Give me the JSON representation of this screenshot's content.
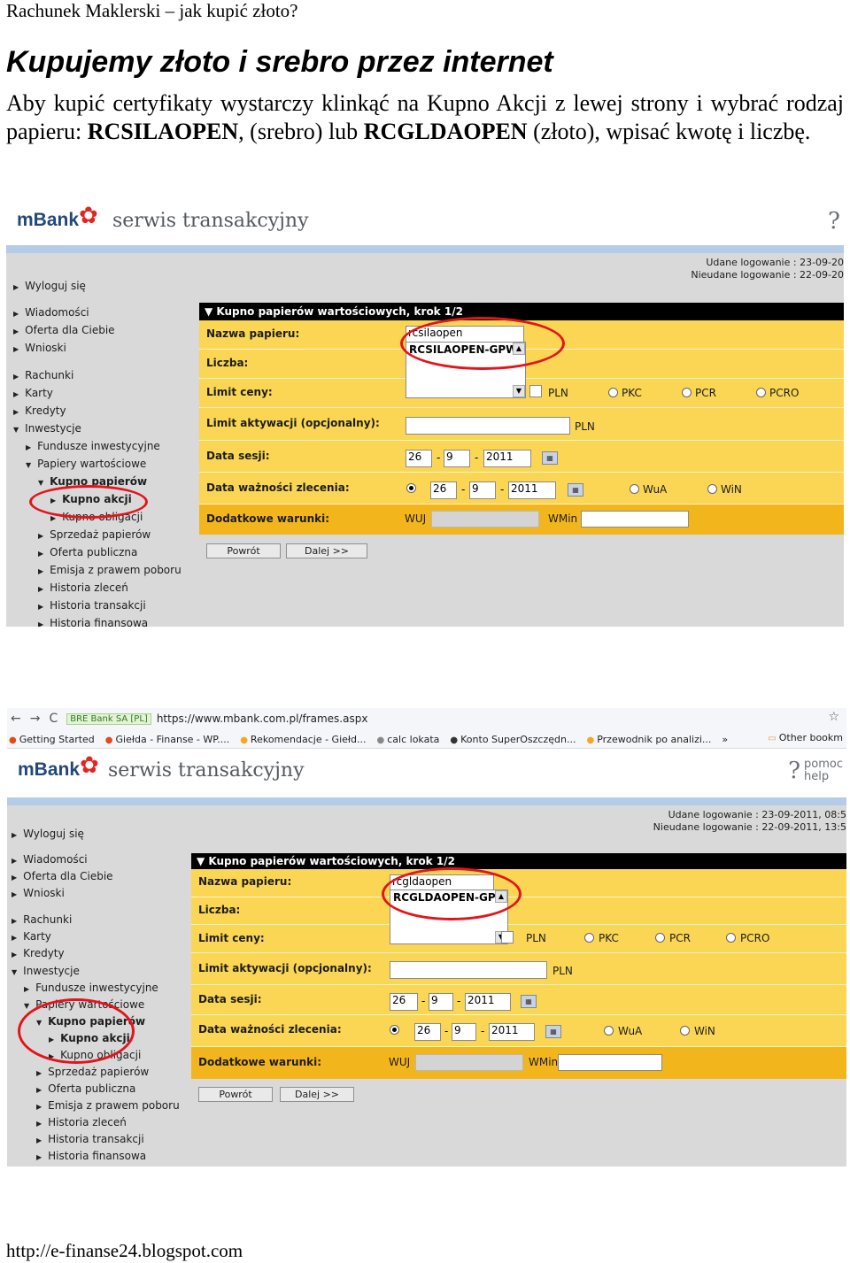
{
  "document": {
    "header": "Rachunek Maklerski – jak kupić złoto?",
    "heading": "Kupujemy złoto i srebro przez internet",
    "paragraph": {
      "part1": "Aby kupić certyfikaty wystarczy klinkąć na Kupno Akcji z lewej strony i wybrać rodzaj papieru: ",
      "silver_code": "RCSILAOPEN",
      "part2": ", (srebro) lub ",
      "gold_code": "RCGLDAOPEN",
      "part3": " (złoto), wpisać kwotę i liczbę."
    },
    "footer": "http://e-finanse24.blogspot.com"
  },
  "browser": {
    "back_glyph": "←",
    "forward_glyph": "→",
    "reload_glyph": "C",
    "ssl_badge": "BRE Bank SA [PL]",
    "url": "https://www.mbank.com.pl/frames.aspx",
    "star_glyph": "☆",
    "bookmarks": [
      "Getting Started",
      "Giełda - Finanse - WP....",
      "Rekomendacje - Giełd...",
      "calc lokata",
      "Konto SuperOszczędn...",
      "Przewodnik po analizi...",
      "»"
    ],
    "other_bookmarks": "Other bookm"
  },
  "bank": {
    "logo": "mBank",
    "service": "serwis transakcyjny",
    "help_glyph": "?",
    "help_line1": "pomoc",
    "help_line2": "help",
    "login_success_1": "Udane logowanie : 23-09-20",
    "login_failed_1": "Nieudane logowanie : 22-09-20",
    "login_success_2": "Udane logowanie : 23-09-2011, 08:5",
    "login_failed_2": "Nieudane logowanie : 22-09-2011, 13:5"
  },
  "sidebar": {
    "items": [
      "Wyloguj się",
      "Wiadomości",
      "Oferta dla Ciebie",
      "Wnioski",
      "Rachunki",
      "Karty",
      "Kredyty",
      "Inwestycje",
      "Fundusze inwestycyjne",
      "Papiery wartościowe",
      "Kupno papierów",
      "Kupno akcji",
      "Kupno obligacji",
      "Sprzedaż papierów",
      "Oferta publiczna",
      "Emisja z prawem poboru",
      "Historia zleceń",
      "Historia transakcji",
      "Historia finansowa"
    ]
  },
  "form": {
    "title": "Kupno papierów wartościowych, krok 1/2",
    "label_name": "Nazwa papieru:",
    "label_qty": "Liczba:",
    "label_limit": "Limit ceny:",
    "label_activation": "Limit aktywacji (opcjonalny):",
    "label_session": "Data sesji:",
    "label_validity": "Data ważności zlecenia:",
    "label_extra": "Dodatkowe warunki:",
    "currency": "PLN",
    "radio_pkc": "PKC",
    "radio_pcr": "PCR",
    "radio_pcro": "PCRO",
    "radio_wua": "WuA",
    "radio_win": "WiN",
    "wuj": "WUJ",
    "wmin": "WMin",
    "day": "26",
    "month": "9",
    "year": "2011",
    "dash": "-",
    "btn_back": "Powrót",
    "btn_next": "Dalej >>"
  },
  "shot1": {
    "search_value": "rcsilaopen",
    "dropdown_option": "RCSILAOPEN-GPW"
  },
  "shot2": {
    "search_value": "rcgldaopen",
    "dropdown_option": "RCGLDAOPEN-GPW"
  }
}
